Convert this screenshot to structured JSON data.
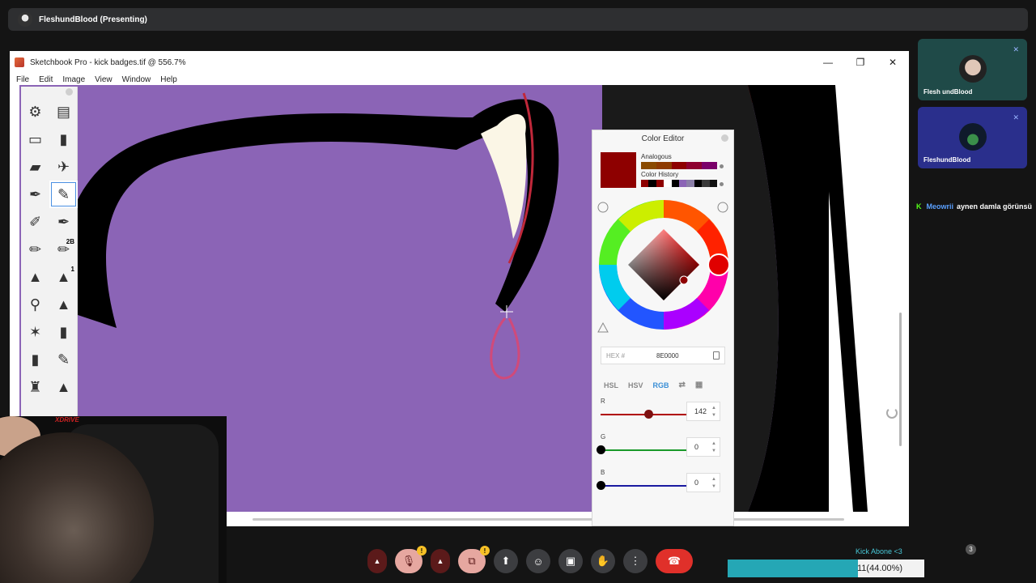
{
  "meeting": {
    "presenter_title": "FleshundBlood (Presenting)"
  },
  "app": {
    "window_title": "Sketchbook Pro - kick badges.tif @ 556.7%",
    "menu": [
      "File",
      "Edit",
      "Image",
      "View",
      "Window",
      "Help"
    ],
    "window_controls": [
      "—",
      "❐",
      "✕"
    ]
  },
  "toolbox": {
    "tools": [
      {
        "icon": "sliders-icon",
        "glyph": "⚙",
        "size": ""
      },
      {
        "icon": "layout-icon",
        "glyph": "▤",
        "size": ""
      },
      {
        "icon": "eraser-icon",
        "glyph": "▭",
        "size": ""
      },
      {
        "icon": "soft-eraser-icon",
        "glyph": "▮",
        "size": ""
      },
      {
        "icon": "ink-jar-icon",
        "glyph": "▰",
        "size": ""
      },
      {
        "icon": "airbrush-icon",
        "glyph": "✈",
        "size": ""
      },
      {
        "icon": "pen-nib-icon",
        "glyph": "✒",
        "size": ""
      },
      {
        "icon": "technical-pen-icon",
        "glyph": "✎",
        "size": ""
      },
      {
        "icon": "marker-icon",
        "glyph": "✐",
        "size": ""
      },
      {
        "icon": "fountain-pen-icon",
        "glyph": "✒",
        "size": ""
      },
      {
        "icon": "pencil-icon",
        "glyph": "✏",
        "size": ""
      },
      {
        "icon": "graphite-pencil-icon",
        "glyph": "✏",
        "size": "2B"
      },
      {
        "icon": "brush-tip-icon",
        "glyph": "▲",
        "size": ""
      },
      {
        "icon": "fine-brush-icon",
        "glyph": "▲",
        "size": "1"
      },
      {
        "icon": "shaving-brush-icon",
        "glyph": "⚲",
        "size": ""
      },
      {
        "icon": "flat-brush-icon",
        "glyph": "▲",
        "size": ""
      },
      {
        "icon": "star-stamp-icon",
        "glyph": "✶",
        "size": ""
      },
      {
        "icon": "red-marker-icon",
        "glyph": "▮",
        "size": ""
      },
      {
        "icon": "paint-tube-icon",
        "glyph": "▮",
        "size": ""
      },
      {
        "icon": "thin-marker-icon",
        "glyph": "✎",
        "size": ""
      },
      {
        "icon": "calligraphy-icon",
        "glyph": "♜",
        "size": ""
      },
      {
        "icon": "ink-brush-icon",
        "glyph": "▲",
        "size": ""
      }
    ],
    "active_index": 7
  },
  "color_editor": {
    "title": "Color Editor",
    "analogous_label": "Analogous",
    "history_label": "Color History",
    "current_color": "#8e0000",
    "analogous": [
      "#8a4a00",
      "#8e3a00",
      "#8e0000",
      "#8e0030",
      "#7a006a"
    ],
    "history": [
      "#8e0000",
      "#000000",
      "#8e0000",
      "#ffffff",
      "#000000",
      "#8b64b6",
      "#8b7fa8",
      "#000000",
      "#3a3a3a",
      "#111111"
    ],
    "hex_label": "HEX #",
    "hex_value": "8E0000",
    "modes": [
      "HSL",
      "HSV",
      "RGB"
    ],
    "active_mode": "RGB",
    "channels": [
      {
        "label": "R",
        "value": "142",
        "fraction": 0.557,
        "color": "#b00000"
      },
      {
        "label": "G",
        "value": "0",
        "fraction": 0,
        "color": "#1a9a2a"
      },
      {
        "label": "B",
        "value": "0",
        "fraction": 0,
        "color": "#1a1aa0"
      }
    ]
  },
  "webcam": {
    "logo": "XDRIVE"
  },
  "participants": [
    {
      "name": "Flesh undBlood"
    },
    {
      "name": "FleshundBlood"
    }
  ],
  "chat": {
    "user": "Meowrii",
    "message": "aynen damla görünsü"
  },
  "controls": {
    "mic_badge": "!",
    "cam_badge": "!",
    "buttons": [
      "caret-up-icon",
      "mic-off-icon",
      "caret-up-icon",
      "camera-off-icon",
      "present-icon",
      "emoji-icon",
      "captions-icon",
      "raise-hand-icon",
      "more-icon",
      "hangup-icon"
    ]
  },
  "goal": {
    "label": "Kick Abone <3",
    "text": "11(44.00%)",
    "progress": 0.44
  },
  "people_count": "3"
}
